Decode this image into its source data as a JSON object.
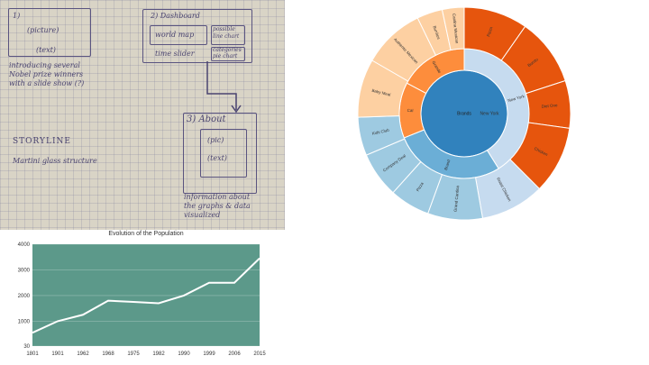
{
  "sketch": {
    "box1_lines": [
      "1)",
      "(picture)",
      "(text)"
    ],
    "intro_text": "introducing several\nNobel prize winners\nwith a slide show (?)",
    "box2_title": "2) Dashboard",
    "world_map": "world map",
    "small_box": "possible\nline chart",
    "time_slider": "time slider",
    "categories": "categories\npie chart",
    "box3_title": "3) About",
    "box3_pic": "(pic)",
    "box3_text": "(text)",
    "storyline": "STORYLINE",
    "martini": "Martini glass structure",
    "about_info": "information about\nthe graphs & data\nvisualized"
  },
  "sunburst": {
    "colors": {
      "orange_dark": "#e6550d",
      "orange_mid": "#fd8d3c",
      "orange_light": "#fdd0a2",
      "blue_dark": "#3182bd",
      "blue_mid": "#6baed6",
      "blue_light": "#9ecae1",
      "blue_pale": "#c6dbef"
    },
    "center_label": "Brands",
    "inner": [
      {
        "label": "New York",
        "color": "blue_dark",
        "a0": 0,
        "a1": 360
      }
    ],
    "middle": [
      {
        "label": "New York",
        "color": "blue_pale",
        "a0": 0,
        "a1": 148
      },
      {
        "label": "Brand",
        "color": "blue_mid",
        "a0": 148,
        "a1": 248
      },
      {
        "label": "Cal",
        "color": "orange_mid",
        "a0": 248,
        "a1": 298
      },
      {
        "label": "Grande",
        "color": "orange_mid",
        "a0": 298,
        "a1": 360
      }
    ],
    "outer": [
      {
        "label": "Pizza",
        "color": "orange_dark",
        "a0": 0,
        "a1": 35
      },
      {
        "label": "Burrito",
        "color": "orange_dark",
        "a0": 35,
        "a1": 72
      },
      {
        "label": "Diet One",
        "color": "orange_dark",
        "a0": 72,
        "a1": 98
      },
      {
        "label": "Chicken",
        "color": "orange_dark",
        "a0": 98,
        "a1": 135
      },
      {
        "label": "Roast Chicken",
        "color": "blue_pale",
        "a0": 135,
        "a1": 170
      },
      {
        "label": "Grand Cantina",
        "color": "blue_light",
        "a0": 170,
        "a1": 200
      },
      {
        "label": "Pizza",
        "color": "blue_light",
        "a0": 200,
        "a1": 222
      },
      {
        "label": "Company Deal",
        "color": "blue_light",
        "a0": 222,
        "a1": 247
      },
      {
        "label": "Kids Club",
        "color": "blue_light",
        "a0": 247,
        "a1": 268
      },
      {
        "label": "Baby Meal",
        "color": "orange_light",
        "a0": 268,
        "a1": 300
      },
      {
        "label": "Authentic Mexican",
        "color": "orange_light",
        "a0": 300,
        "a1": 334
      },
      {
        "label": "Burritos",
        "color": "orange_light",
        "a0": 334,
        "a1": 348
      },
      {
        "label": "Cantina Mexican",
        "color": "orange_light",
        "a0": 348,
        "a1": 360
      }
    ]
  },
  "chart_data": {
    "type": "line",
    "title": "Evolution of the Population",
    "categories": [
      "1801",
      "1901",
      "1962",
      "1968",
      "1975",
      "1982",
      "1990",
      "1999",
      "2006",
      "2015"
    ],
    "values": [
      550,
      1000,
      1250,
      1800,
      1750,
      1700,
      2000,
      2500,
      2500,
      3450
    ],
    "y_ticks": [
      "30",
      "1000",
      "2000",
      "3000",
      "4000"
    ],
    "ylim": [
      30,
      4000
    ],
    "background": "#5c998a",
    "line_color": "#ffffff",
    "grid": true
  }
}
